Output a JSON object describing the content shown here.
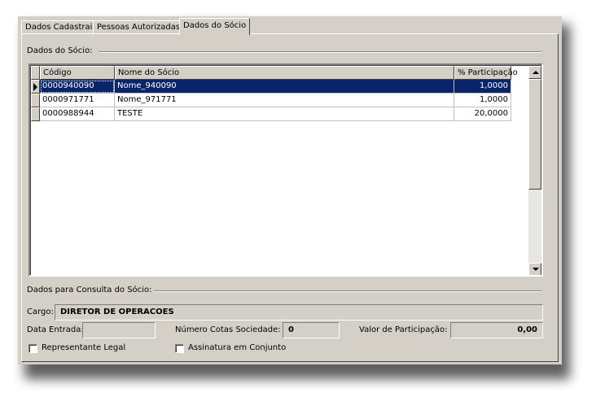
{
  "tabs": [
    {
      "label": "Dados Cadastrais"
    },
    {
      "label": "Pessoas Autorizadas"
    },
    {
      "label": "Dados do Sócio"
    }
  ],
  "socio_group": {
    "title": "Dados do Sócio:"
  },
  "grid": {
    "columns": [
      "Código",
      "Nome do Sócio",
      "% Participação"
    ],
    "rows": [
      {
        "codigo": "0000940090",
        "nome": "Nome_940090",
        "participacao": "1,0000",
        "selected": true
      },
      {
        "codigo": "0000971771",
        "nome": "Nome_971771",
        "participacao": "1,0000",
        "selected": false
      },
      {
        "codigo": "0000988944",
        "nome": "TESTE",
        "participacao": "20,0000",
        "selected": false
      }
    ]
  },
  "consulta_group": {
    "title": "Dados para Consulta do Sócio:"
  },
  "cargo": {
    "label": "Cargo:",
    "value": "DIRETOR DE OPERACOES"
  },
  "data_entrada": {
    "label": "Data Entrada:",
    "value": ""
  },
  "num_cotas": {
    "label": "Número Cotas Sociedade:",
    "value": "0"
  },
  "valor_participacao": {
    "label": "Valor de Participação:",
    "value": "0,00"
  },
  "representante_legal": {
    "label": "Representante Legal",
    "checked": false
  },
  "assinatura_conjunto": {
    "label": "Assinatura em Conjunto",
    "checked": false
  },
  "colors": {
    "selection": "#0a246a",
    "face": "#d4d0c8"
  }
}
